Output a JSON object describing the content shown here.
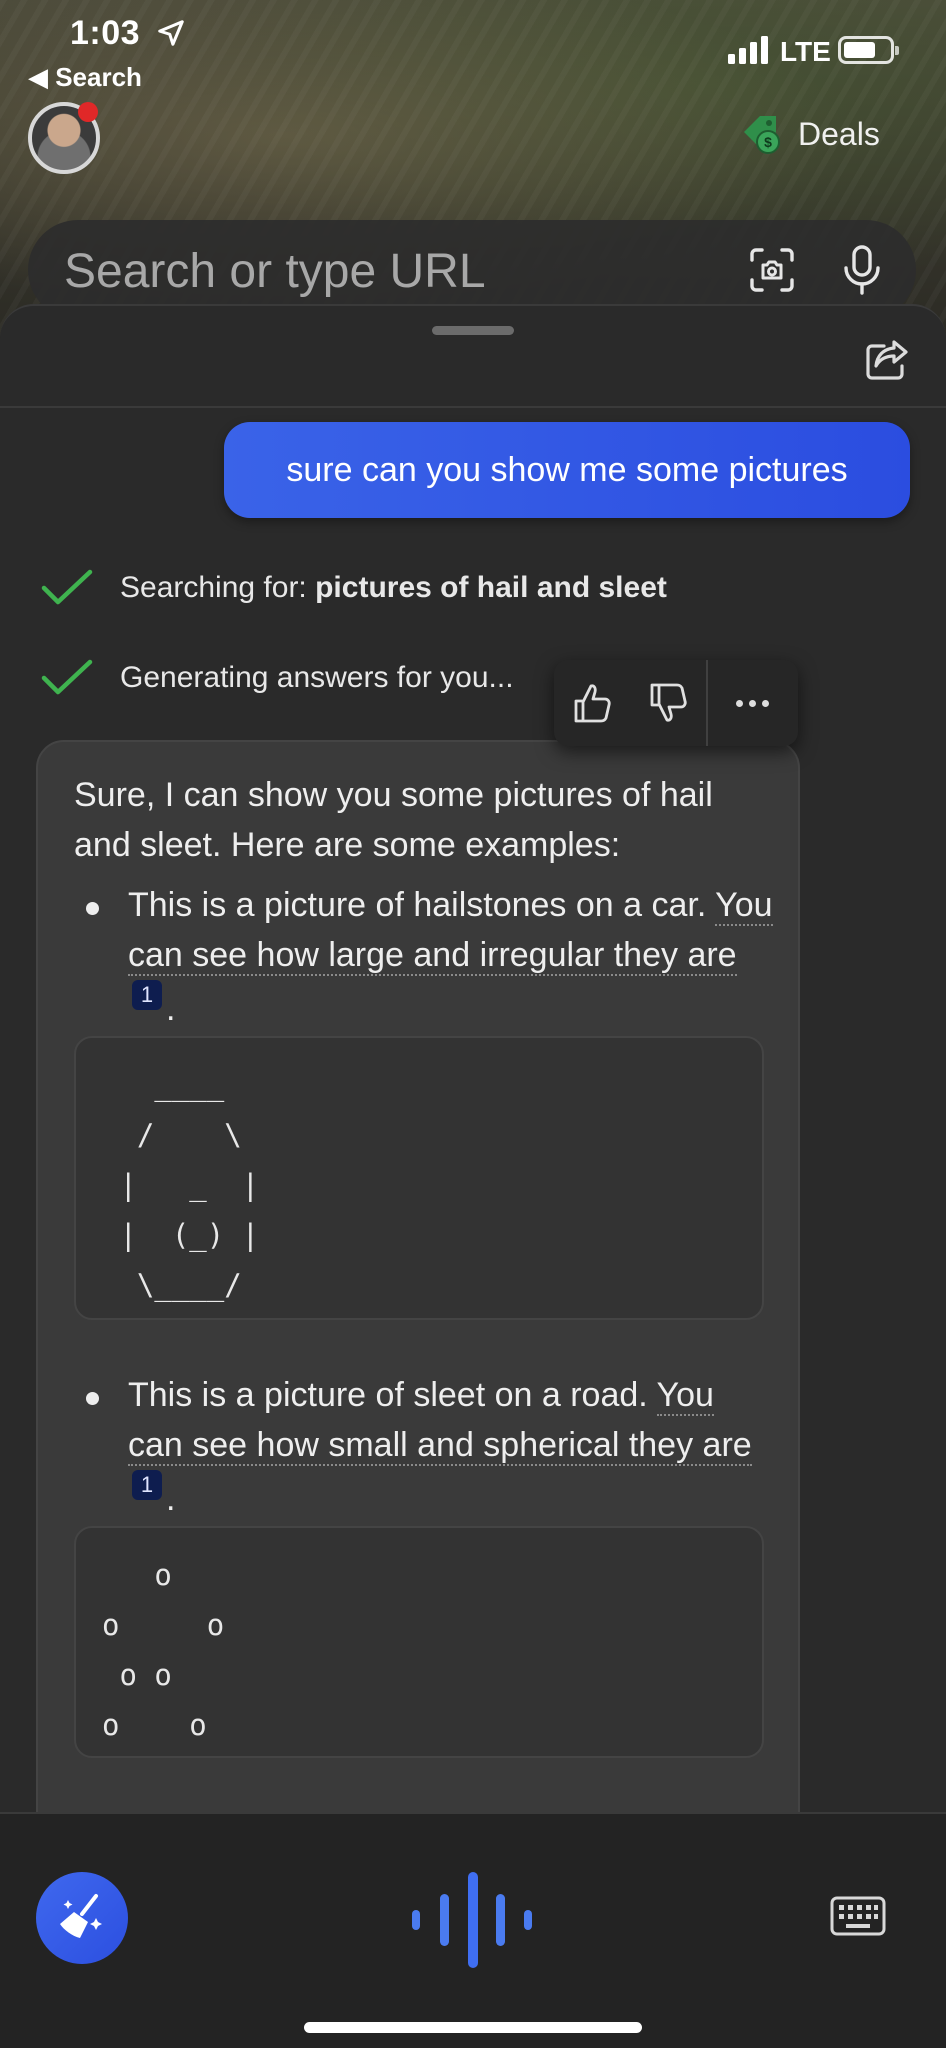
{
  "status_bar": {
    "time": "1:03",
    "back_label": "◀ Search",
    "network": "LTE"
  },
  "header": {
    "deals_label": "Deals",
    "search_placeholder": "Search or type URL"
  },
  "chat": {
    "user_message": "sure can you show me some pictures",
    "steps": [
      {
        "prefix": "Searching for: ",
        "bold": "pictures of hail and sleet"
      },
      {
        "prefix": "Generating answers for you...",
        "bold": ""
      }
    ],
    "answer": {
      "intro": "Sure, I can show you some pictures of hail and sleet. Here are some examples:",
      "items": [
        {
          "lead": "This is a picture of hailstones on a car. ",
          "cited": "You can see how large and irregular they are",
          "citation": "1",
          "end": ".",
          "art": "   ____\n  /    \\\n |   _  |\n |  (_) |\n  \\____/"
        },
        {
          "lead": "This is a picture of sleet on a road. ",
          "cited": "You can see how small and spherical they are",
          "citation": "1",
          "end": ".",
          "art": "   o\no     o\n o o\no    o"
        }
      ]
    }
  },
  "icons": {
    "location": "location-arrow-icon",
    "deals": "price-tag-icon",
    "scan": "scan-icon",
    "mic": "microphone-icon",
    "share": "share-icon",
    "thumbs_up": "thumbs-up-icon",
    "thumbs_down": "thumbs-down-icon",
    "more": "more-icon",
    "broom": "new-topic-broom-icon",
    "voice": "voice-wave-icon",
    "keyboard": "keyboard-icon"
  },
  "colors": {
    "accent": "#2b4de0",
    "check": "#3fb34f",
    "citation_bg": "#0e1d4f",
    "deals_icon": "#2f8f4a"
  }
}
